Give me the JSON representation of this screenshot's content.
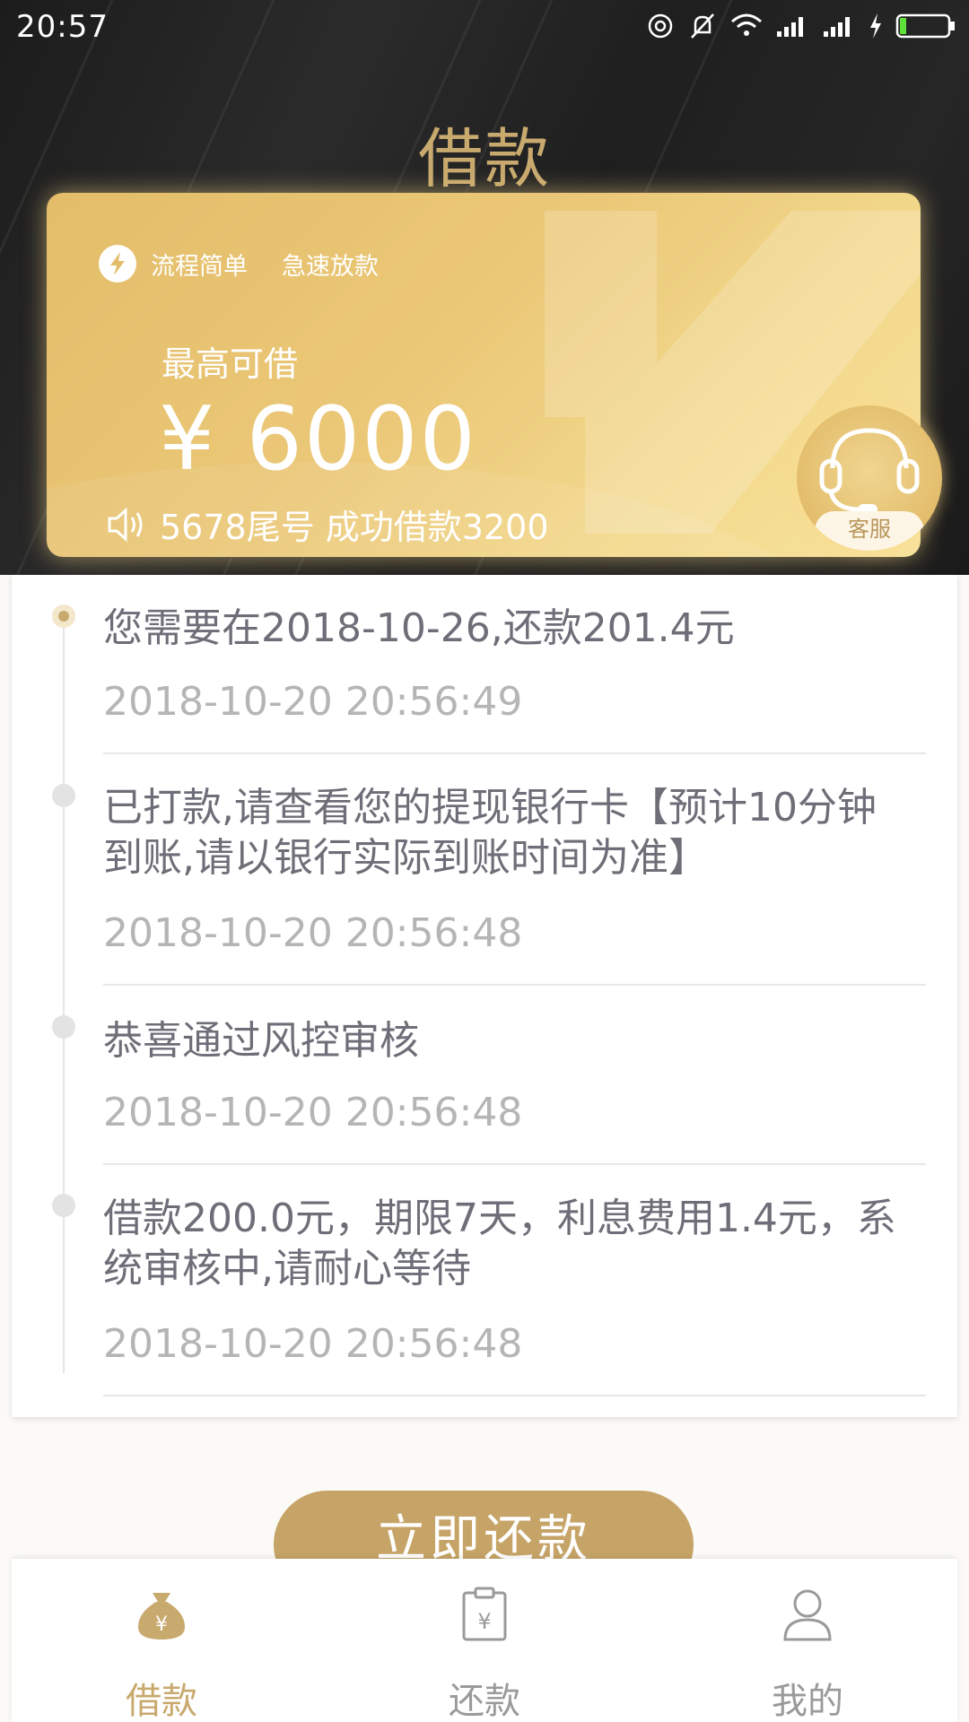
{
  "status_bar": {
    "time": "20:57"
  },
  "header": {
    "title": "借款"
  },
  "card": {
    "tag_1": "流程简单",
    "tag_2": "急速放款",
    "max_label": "最高可借",
    "amount": "¥ 6000",
    "notice": "5678尾号 成功借款3200"
  },
  "customer_service": {
    "label": "客服"
  },
  "timeline": [
    {
      "message": "您需要在2018-10-26,还款201.4元",
      "time": "2018-10-20 20:56:49",
      "active": true
    },
    {
      "message": "已打款,请查看您的提现银行卡【预计10分钟到账,请以银行实际到账时间为准】",
      "time": "2018-10-20 20:56:48",
      "active": false
    },
    {
      "message": "恭喜通过风控审核",
      "time": "2018-10-20 20:56:48",
      "active": false
    },
    {
      "message": "借款200.0元，期限7天，利息费用1.4元，系统审核中,请耐心等待",
      "time": "2018-10-20 20:56:48",
      "active": false
    }
  ],
  "repay_button": {
    "label": "立即还款"
  },
  "bottom_nav": [
    {
      "label": "借款",
      "icon": "money-bag-icon",
      "active": true
    },
    {
      "label": "还款",
      "icon": "repay-clipboard-icon",
      "active": false
    },
    {
      "label": "我的",
      "icon": "user-icon",
      "active": false
    }
  ],
  "colors": {
    "gold": "#c8a96e",
    "card_gold": "#ebc878",
    "dark_bg": "#222222"
  }
}
